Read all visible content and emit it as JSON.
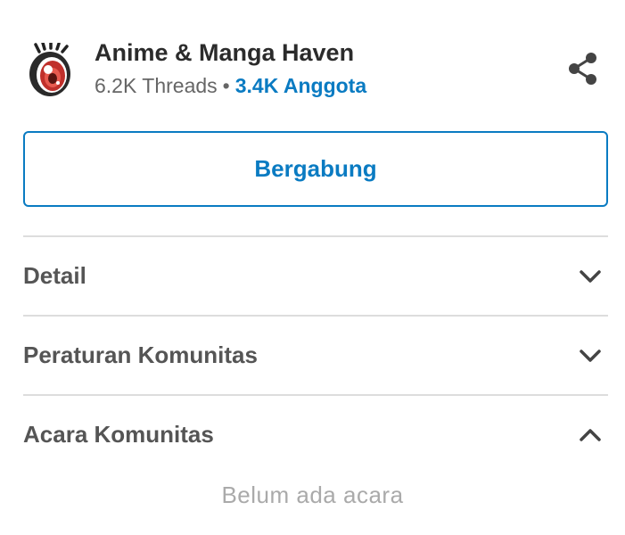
{
  "community": {
    "name": "Anime & Manga Haven",
    "threads": "6.2K Threads",
    "separator": "•",
    "members": "3.4K Anggota",
    "logo_icon": "anime-eye-logo"
  },
  "actions": {
    "share_icon": "share-icon",
    "join_label": "Bergabung"
  },
  "sections": [
    {
      "label": "Detail",
      "expanded": false
    },
    {
      "label": "Peraturan Komunitas",
      "expanded": false
    },
    {
      "label": "Acara Komunitas",
      "expanded": true
    }
  ],
  "events": {
    "empty_text": "Belum ada acara"
  },
  "colors": {
    "accent": "#0a7bc2",
    "title": "#2b2b2b",
    "muted": "#666666",
    "section_text": "#555555",
    "divider": "#dddddd",
    "empty_text": "#aaaaaa"
  }
}
